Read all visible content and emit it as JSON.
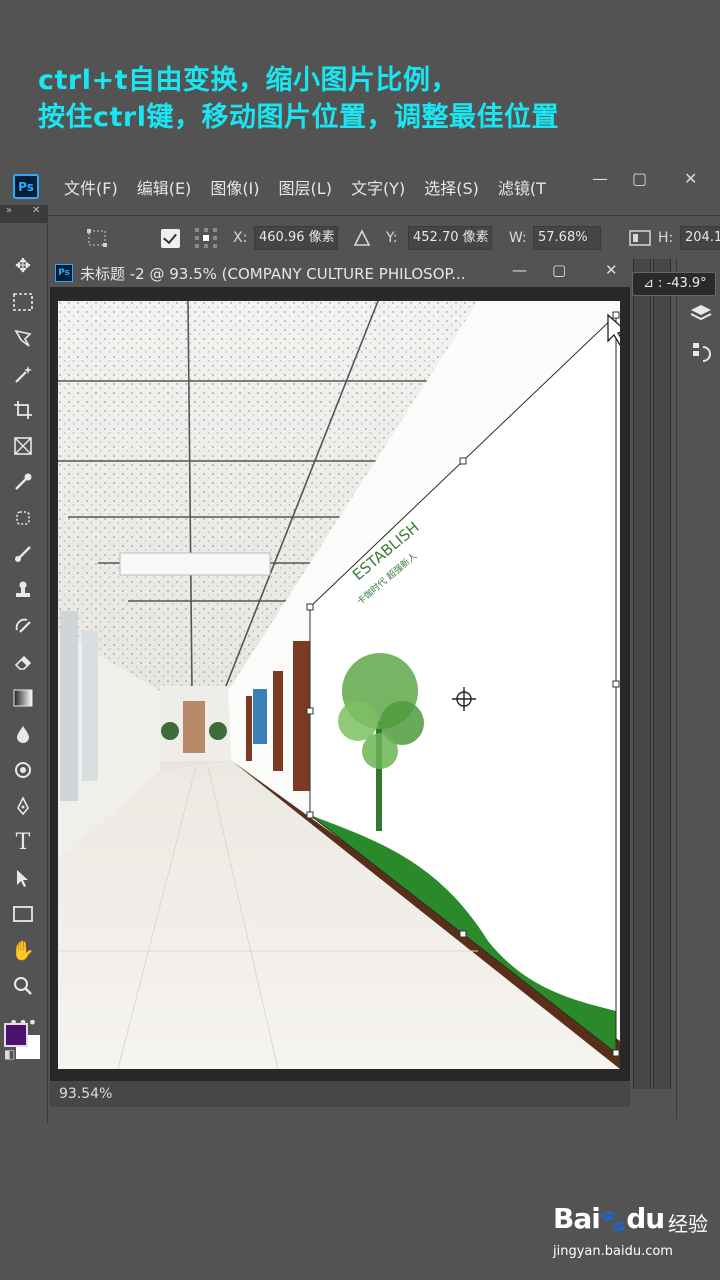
{
  "caption": {
    "line1": "ctrl+t自由变换，缩小图片比例，",
    "line2": "按住ctrl键，移动图片位置，调整最佳位置"
  },
  "app": {
    "logo": "Ps",
    "menu": [
      "文件(F)",
      "编辑(E)",
      "图像(I)",
      "图层(L)",
      "文字(Y)",
      "选择(S)",
      "滤镜(T"
    ],
    "window_controls": [
      "—",
      "▢",
      "✕"
    ]
  },
  "options": {
    "x_label": "X:",
    "x_value": "460.96 像素",
    "y_label": "Y:",
    "y_value": "452.70 像素",
    "w_label": "W:",
    "w_value": "57.68%",
    "h_label": "H:",
    "h_value": "204.1"
  },
  "document": {
    "title": "未标题 -2 @ 93.5% (COMPANY CULTURE  PHILOSOP...",
    "zoom": "93.54%",
    "angle": "⊿ : -43.9°",
    "poster_heading": "ESTABLISH",
    "poster_sub": "卡伽时代 超强新人"
  },
  "toolbar": {
    "collapse": "»",
    "close": "✕"
  },
  "icons": [
    "move-icon",
    "marquee-icon",
    "lasso-icon",
    "magic-wand-icon",
    "crop-icon",
    "frame-icon",
    "eyedropper-icon",
    "healing-icon",
    "brush-icon",
    "stamp-icon",
    "history-brush-icon",
    "eraser-icon",
    "gradient-icon",
    "blur-icon",
    "dodge-icon",
    "pen-icon",
    "type-icon",
    "path-select-icon",
    "rectangle-icon",
    "hand-icon",
    "zoom-icon",
    "more-icon"
  ],
  "colors": {
    "caption": "#19e6f0",
    "foreground": "#4a1170",
    "background": "#ffffff",
    "grass": "#2a8a2a"
  },
  "watermark": {
    "brand": "Bai",
    "brand2": "du",
    "product": "经验",
    "url": "jingyan.baidu.com"
  }
}
